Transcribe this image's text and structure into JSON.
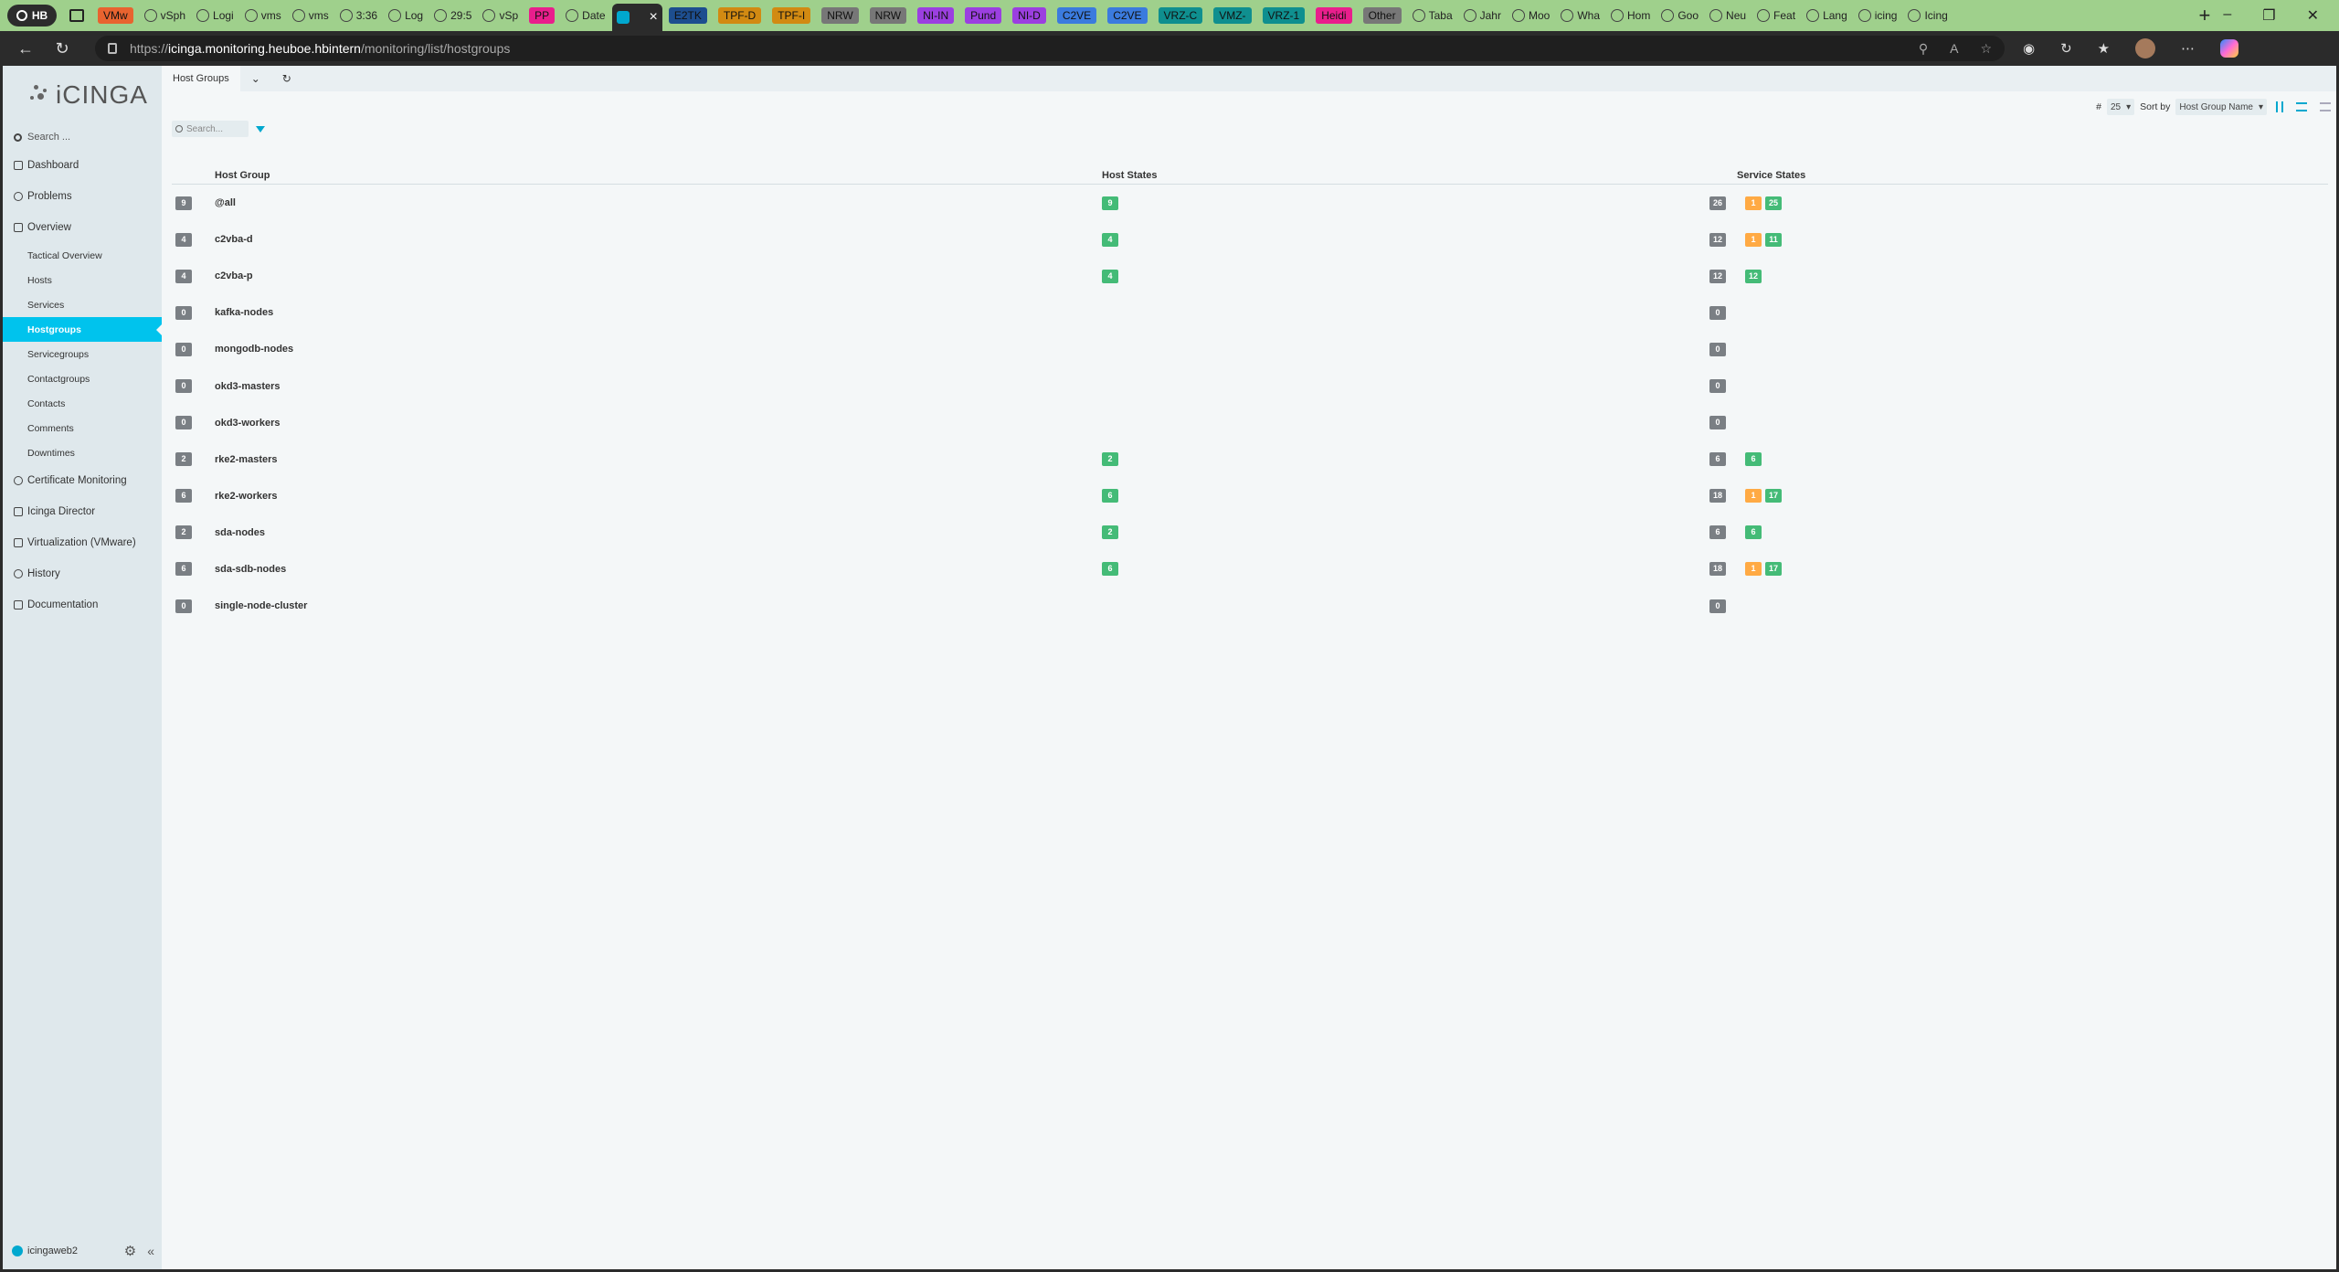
{
  "browser": {
    "profile_label": "HB",
    "tabs": [
      {
        "label": "VMw",
        "color": "#e8632f",
        "kind": "pill"
      },
      {
        "label": "vSph",
        "kind": "fav"
      },
      {
        "label": "Logi",
        "kind": "fav"
      },
      {
        "label": "vms",
        "kind": "fav"
      },
      {
        "label": "vms",
        "kind": "fav"
      },
      {
        "label": "3:36",
        "kind": "fav"
      },
      {
        "label": "Log",
        "kind": "fav"
      },
      {
        "label": "29:5",
        "kind": "fav"
      },
      {
        "label": "vSp",
        "kind": "fav"
      },
      {
        "label": "PP",
        "color": "#e91e8c",
        "kind": "pill"
      },
      {
        "label": "Date",
        "kind": "fav"
      },
      {
        "label": "",
        "kind": "active"
      },
      {
        "label": "E2TK",
        "color": "#1d4e8f",
        "kind": "pill"
      },
      {
        "label": "TPF-D",
        "color": "#d28a12",
        "kind": "pill"
      },
      {
        "label": "TPF-I",
        "color": "#d28a12",
        "kind": "pill"
      },
      {
        "label": "NRW",
        "color": "#777777",
        "kind": "pill"
      },
      {
        "label": "NRW",
        "color": "#777777",
        "kind": "pill"
      },
      {
        "label": "NI-IN",
        "color": "#9b3fe0",
        "kind": "pill"
      },
      {
        "label": "Pund",
        "color": "#9b3fe0",
        "kind": "pill"
      },
      {
        "label": "NI-D",
        "color": "#9b3fe0",
        "kind": "pill"
      },
      {
        "label": "C2VE",
        "color": "#3b7bde",
        "kind": "pill"
      },
      {
        "label": "C2VE",
        "color": "#3b7bde",
        "kind": "pill"
      },
      {
        "label": "VRZ-C",
        "color": "#0f8f8f",
        "kind": "pill"
      },
      {
        "label": "VMZ-",
        "color": "#0f8f8f",
        "kind": "pill"
      },
      {
        "label": "VRZ-1",
        "color": "#0f8f8f",
        "kind": "pill"
      },
      {
        "label": "Heidi",
        "color": "#e91e8c",
        "kind": "pill"
      },
      {
        "label": "Other",
        "color": "#777777",
        "kind": "pill"
      },
      {
        "label": "Taba",
        "kind": "fav"
      },
      {
        "label": "Jahr",
        "kind": "fav"
      },
      {
        "label": "Moo",
        "kind": "fav"
      },
      {
        "label": "Wha",
        "kind": "fav"
      },
      {
        "label": "Hom",
        "kind": "fav"
      },
      {
        "label": "Goo",
        "kind": "fav"
      },
      {
        "label": "Neu",
        "kind": "fav"
      },
      {
        "label": "Feat",
        "kind": "fav"
      },
      {
        "label": "Lang",
        "kind": "fav"
      },
      {
        "label": "icing",
        "kind": "fav"
      },
      {
        "label": "Icing",
        "kind": "fav"
      }
    ],
    "url_proto": "https://",
    "url_host": "icinga.monitoring.heuboe.hbintern",
    "url_path": "/monitoring/list/hostgroups"
  },
  "sidebar": {
    "logo_text": "iCINGA",
    "search_placeholder": "Search ...",
    "items": [
      {
        "label": "Dashboard"
      },
      {
        "label": "Problems"
      },
      {
        "label": "Overview"
      }
    ],
    "subitems": [
      {
        "label": "Tactical Overview"
      },
      {
        "label": "Hosts"
      },
      {
        "label": "Services"
      },
      {
        "label": "Hostgroups"
      },
      {
        "label": "Servicegroups"
      },
      {
        "label": "Contactgroups"
      },
      {
        "label": "Contacts"
      },
      {
        "label": "Comments"
      },
      {
        "label": "Downtimes"
      }
    ],
    "lower_items": [
      {
        "label": "Certificate Monitoring"
      },
      {
        "label": "Icinga Director"
      },
      {
        "label": "Virtualization (VMware)"
      },
      {
        "label": "History"
      },
      {
        "label": "Documentation"
      }
    ],
    "username": "icingaweb2"
  },
  "main": {
    "tab_label": "Host Groups",
    "limit_label": "#",
    "limit_value": "25",
    "sort_label": "Sort by",
    "sort_value": "Host Group Name",
    "search_placeholder": "Search...",
    "columns": {
      "name": "Host Group",
      "host_states": "Host States",
      "service_states": "Service States"
    },
    "rows": [
      {
        "count": "9",
        "name": "@all",
        "host_ok": "9",
        "svc_total": "26",
        "svc_warn": "1",
        "svc_ok": "25"
      },
      {
        "count": "4",
        "name": "c2vba-d",
        "host_ok": "4",
        "svc_total": "12",
        "svc_warn": "1",
        "svc_ok": "11"
      },
      {
        "count": "4",
        "name": "c2vba-p",
        "host_ok": "4",
        "svc_total": "12",
        "svc_warn": "",
        "svc_ok": "12"
      },
      {
        "count": "0",
        "name": "kafka-nodes",
        "host_ok": "",
        "svc_total": "0",
        "svc_warn": "",
        "svc_ok": ""
      },
      {
        "count": "0",
        "name": "mongodb-nodes",
        "host_ok": "",
        "svc_total": "0",
        "svc_warn": "",
        "svc_ok": ""
      },
      {
        "count": "0",
        "name": "okd3-masters",
        "host_ok": "",
        "svc_total": "0",
        "svc_warn": "",
        "svc_ok": ""
      },
      {
        "count": "0",
        "name": "okd3-workers",
        "host_ok": "",
        "svc_total": "0",
        "svc_warn": "",
        "svc_ok": ""
      },
      {
        "count": "2",
        "name": "rke2-masters",
        "host_ok": "2",
        "svc_total": "6",
        "svc_warn": "",
        "svc_ok": "6"
      },
      {
        "count": "6",
        "name": "rke2-workers",
        "host_ok": "6",
        "svc_total": "18",
        "svc_warn": "1",
        "svc_ok": "17"
      },
      {
        "count": "2",
        "name": "sda-nodes",
        "host_ok": "2",
        "svc_total": "6",
        "svc_warn": "",
        "svc_ok": "6"
      },
      {
        "count": "6",
        "name": "sda-sdb-nodes",
        "host_ok": "6",
        "svc_total": "18",
        "svc_warn": "1",
        "svc_ok": "17"
      },
      {
        "count": "0",
        "name": "single-node-cluster",
        "host_ok": "",
        "svc_total": "0",
        "svc_warn": "",
        "svc_ok": ""
      }
    ]
  },
  "colors": {
    "accent": "#00c3ed",
    "ok": "#44bb77",
    "warning": "#ffaa44",
    "pending": "#7a7f84"
  }
}
